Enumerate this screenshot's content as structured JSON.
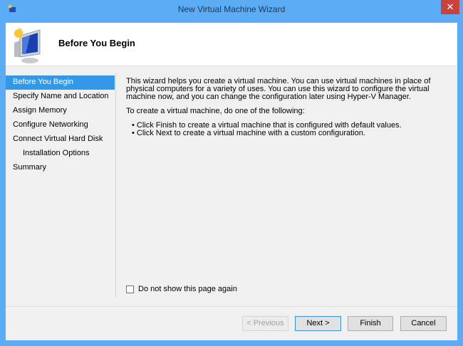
{
  "window": {
    "title": "New Virtual Machine Wizard",
    "close": "✕"
  },
  "header": {
    "title": "Before You Begin"
  },
  "nav": [
    "Before You Begin",
    "Specify Name and Location",
    "Assign Memory",
    "Configure Networking",
    "Connect Virtual Hard Disk",
    "Installation Options",
    "Summary"
  ],
  "content": {
    "intro": "This wizard helps you create a virtual machine. You can use virtual machines in place of physical computers for a variety of uses. You can use this wizard to configure the virtual machine now, and you can change the configuration later using Hyper-V Manager.",
    "lead": "To create a virtual machine, do one of the following:",
    "bullets": [
      "Click Finish to create a virtual machine that is configured with default values.",
      "Click Next to create a virtual machine with a custom configuration."
    ]
  },
  "checkbox": {
    "label": "Do not show this page again",
    "checked": false
  },
  "buttons": {
    "previous": "< Previous",
    "next": "Next >",
    "finish": "Finish",
    "cancel": "Cancel"
  }
}
